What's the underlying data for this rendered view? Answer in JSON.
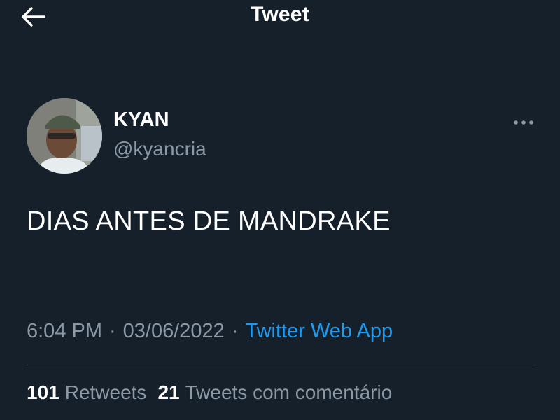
{
  "header": {
    "title": "Tweet",
    "back_icon": "arrow-left-icon"
  },
  "author": {
    "name": "KYAN",
    "handle": "@kyancria",
    "more_icon": "more-horizontal-icon"
  },
  "tweet": {
    "text": "DIAS ANTES DE MANDRAKE",
    "time": "6:04 PM",
    "separator": "·",
    "date": "03/06/2022",
    "source": "Twitter Web App"
  },
  "stats": {
    "retweets_count": "101",
    "retweets_label": "Retweets",
    "quotes_count": "21",
    "quotes_label": "Tweets com comentário"
  },
  "colors": {
    "background": "#15202b",
    "primary_text": "#ffffff",
    "secondary_text": "#8b98a5",
    "link": "#1d9bf0",
    "divider": "#38444d"
  }
}
